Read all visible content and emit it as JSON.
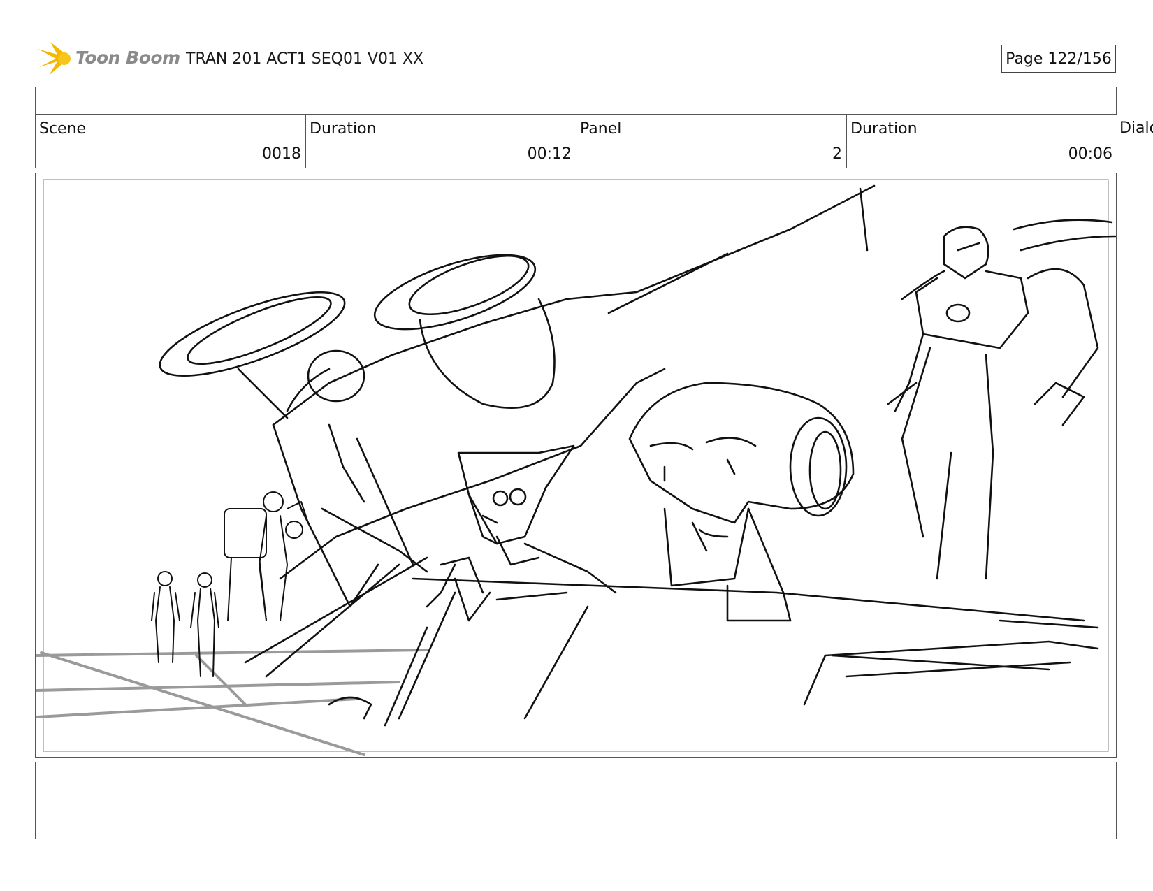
{
  "header": {
    "logo_text": "Toon Boom",
    "title": "TRAN 201 ACT1 SEQ01 V01 XX",
    "page": "Page 122/156"
  },
  "info": {
    "scene_label": "Scene",
    "scene_value": "0018",
    "duration_label": "Duration",
    "duration_value": "00:12",
    "panel_label": "Panel",
    "panel_value": "2",
    "panel_duration_label": "Duration",
    "panel_duration_value": "00:06",
    "dialog_label": "Dialo"
  },
  "colors": {
    "logo_star": "#f5b800",
    "logo_text": "#8a8a8a",
    "border": "#555555"
  }
}
